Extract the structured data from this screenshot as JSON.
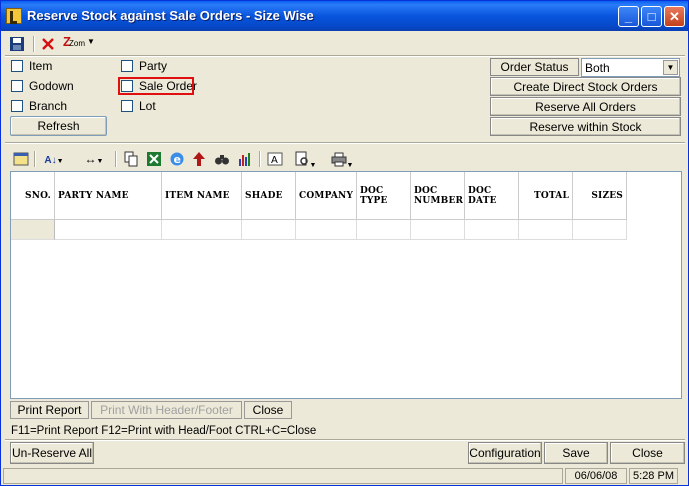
{
  "window": {
    "title": "Reserve Stock against Sale Orders - Size Wise"
  },
  "toolbar": {
    "save_icon": "floppy-disk-icon",
    "cancel_icon": "red-x-icon",
    "zoom_label": "Zom"
  },
  "filters": {
    "item": "Item",
    "godown": "Godown",
    "branch": "Branch",
    "party": "Party",
    "sale_order": "Sale Order",
    "lot": "Lot",
    "refresh": "Refresh"
  },
  "order_status": {
    "label": "Order Status",
    "value": "Both"
  },
  "right_buttons": {
    "create_direct": "Create Direct Stock Orders",
    "reserve_all": "Reserve All Orders",
    "reserve_within": "Reserve within Stock"
  },
  "grid": {
    "columns": [
      "SNO.",
      "PARTY NAME",
      "ITEM NAME",
      "SHADE",
      "COMPANY",
      "DOC TYPE",
      "DOC NUMBER",
      "DOC DATE",
      "TOTAL",
      "SIZES"
    ]
  },
  "report_buttons": {
    "print_report": "Print Report",
    "print_header": "Print With Header/Footer",
    "close": "Close"
  },
  "shortcut_text": "F11=Print Report  F12=Print with Head/Foot  CTRL+C=Close",
  "footer_buttons": {
    "unreserve_all": "Un-Reserve All",
    "configuration": "Configuration",
    "save": "Save",
    "close": "Close"
  },
  "status": {
    "date": "06/06/08",
    "time": "5:28 PM"
  },
  "colors": {
    "title_bar": "#0855dd",
    "highlight_border": "#e01010"
  }
}
